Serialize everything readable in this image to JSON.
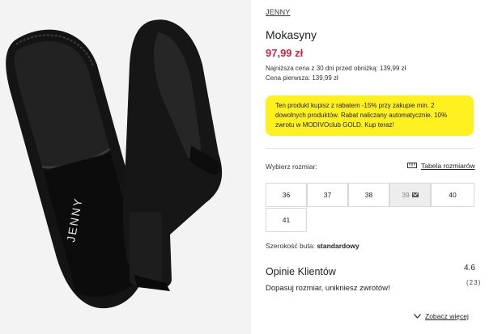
{
  "product": {
    "brand": "JENNY",
    "name": "Mokasyny",
    "price": "97,99 zł",
    "lowest_price_30_days": "Najniższa cena z 30 dni przed obniżką: 139,99 zł",
    "first_price": "Cena pierwsza: 139,99 zł",
    "image_logo_text": "JENNY"
  },
  "promo": {
    "text": "Ten produkt kupisz z rabatem -15% przy zakupie min. 2 dowolnych produktów. Rabat naliczany automatycznie. 10% zwrotu w MODIVOclub GOLD. Kup teraz!",
    "background": "#fff01f"
  },
  "sizes": {
    "label": "Wybierz rozmiar:",
    "table_link": "Tabela rozmiarów",
    "options": [
      {
        "value": "36",
        "available": true
      },
      {
        "value": "37",
        "available": true
      },
      {
        "value": "38",
        "available": true
      },
      {
        "value": "39",
        "available": false
      },
      {
        "value": "40",
        "available": true
      },
      {
        "value": "41",
        "available": true
      }
    ]
  },
  "width": {
    "label": "Szerokość buta:",
    "value": "standardowy"
  },
  "reviews": {
    "title": "Opinie Klientów",
    "rating": "4.6",
    "count": "(23)",
    "hint": "Dopasuj rozmiar, unikniesz zwrotów!",
    "more_link": "Zobacz więcej"
  },
  "colors": {
    "price": "#d6223c",
    "promo_background": "#fff01f",
    "unavailable_size": "#ededed"
  }
}
